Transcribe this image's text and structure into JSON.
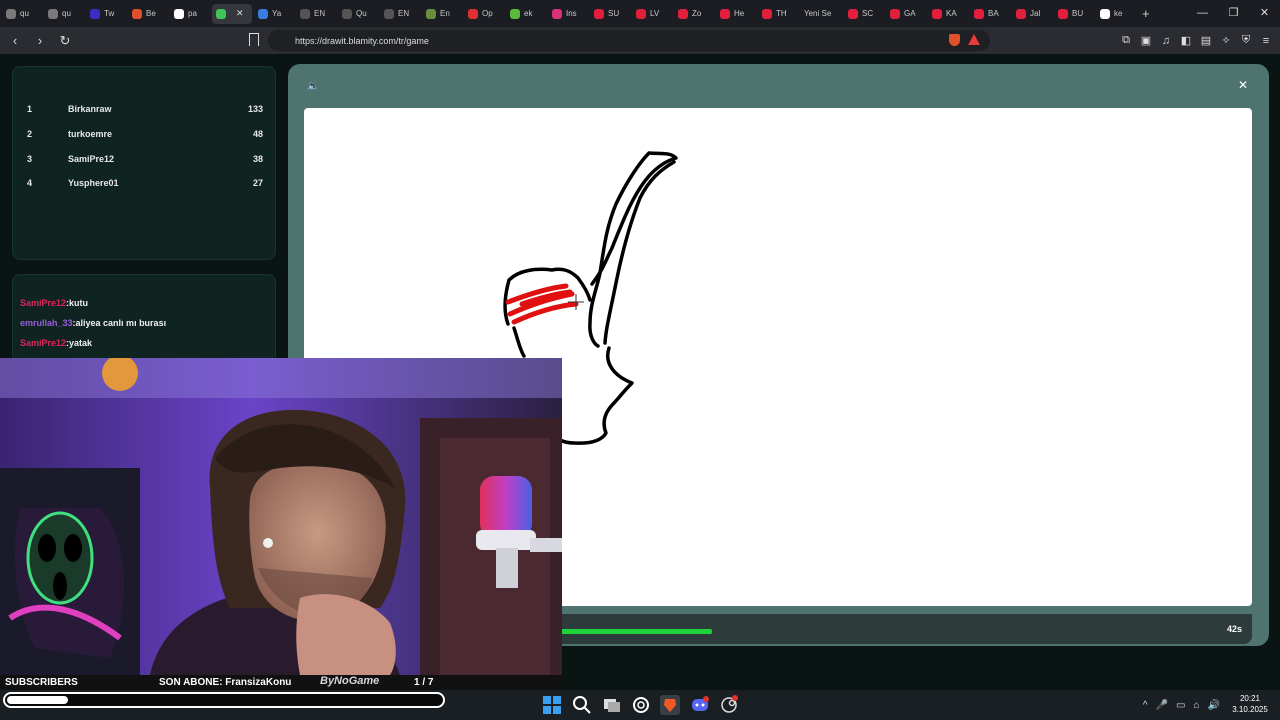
{
  "browser": {
    "tabs": [
      {
        "label": "qu",
        "color": "#7a7a7a"
      },
      {
        "label": "qu",
        "color": "#7a7a7a"
      },
      {
        "label": "Tw",
        "color": "#3b2cc7"
      },
      {
        "label": "Be",
        "color": "#e0502a"
      },
      {
        "label": "pa",
        "color": "#ffffff"
      },
      {
        "label": "",
        "color": "#41c45a",
        "active": true
      },
      {
        "label": "Ya",
        "color": "#3a7ce0"
      },
      {
        "label": "EN",
        "color": "#555555"
      },
      {
        "label": "Qu",
        "color": "#555555"
      },
      {
        "label": "EN",
        "color": "#555555"
      },
      {
        "label": "En",
        "color": "#6a8e3e"
      },
      {
        "label": "Op",
        "color": "#e03030"
      },
      {
        "label": "ek",
        "color": "#5ab83a"
      },
      {
        "label": "Ins",
        "color": "#d9307a"
      },
      {
        "label": "SU",
        "color": "#e01f3d"
      },
      {
        "label": "LV",
        "color": "#e01f3d"
      },
      {
        "label": "Zo",
        "color": "#e01f3d"
      },
      {
        "label": "He",
        "color": "#e01f3d"
      },
      {
        "label": "TH",
        "color": "#e01f3d"
      },
      {
        "label": "Yeni Se",
        "color": ""
      },
      {
        "label": "SC",
        "color": "#e01f3d"
      },
      {
        "label": "GA",
        "color": "#e01f3d"
      },
      {
        "label": "KA",
        "color": "#e01f3d"
      },
      {
        "label": "BA",
        "color": "#e01f3d"
      },
      {
        "label": "Jal",
        "color": "#e01f3d"
      },
      {
        "label": "BU",
        "color": "#e01f3d"
      },
      {
        "label": "ke",
        "color": "#ffffff"
      }
    ],
    "url": "https://drawit.blamity.com/tr/game",
    "new_tab_glyph": "+",
    "window_controls": [
      "—",
      "❐",
      "✕"
    ],
    "nav_glyphs": [
      "‹",
      "›",
      "↻"
    ],
    "extension_glyphs": [
      "⧉",
      "▣",
      "♫",
      "◧",
      "▤",
      "✧",
      "⛨",
      "≡"
    ]
  },
  "leaderboard": [
    {
      "rank": "1",
      "name": "Birkanraw",
      "score": "133"
    },
    {
      "rank": "2",
      "name": "turkoemre",
      "score": "48"
    },
    {
      "rank": "3",
      "name": "SamiPre12",
      "score": "38"
    },
    {
      "rank": "4",
      "name": "Yusphere01",
      "score": "27"
    }
  ],
  "chat": [
    {
      "user": "SamiPre12",
      "message": ":kutu",
      "color": "#e0245e"
    },
    {
      "user": "emrullah_33",
      "message": ":aliyea canlı mı burası",
      "color": "#9a5ce0"
    },
    {
      "user": "SamiPre12",
      "message": ":yatak",
      "color": "#e0245e"
    }
  ],
  "game": {
    "sound_glyph": "🔈",
    "close_glyph": "✕",
    "timer_text": "42s",
    "timer_progress": 0.45
  },
  "stream": {
    "subscribers_label": "SUBSCRIBERS",
    "last_sub_text": "SON ABONE: FransizaKonu",
    "brand_logo": "ByNoGame",
    "sub_count": "1  / 7",
    "sub_progress": 0.14
  },
  "taskbar": {
    "time": "20:21",
    "date": "3.10.2025",
    "tray_glyphs": [
      "^",
      "🎤",
      "▭",
      "⌂",
      "🔊"
    ]
  },
  "colors": {
    "accent_green": "#1fd13a",
    "panel_teal": "#4f736e",
    "chat_red": "#e0245e",
    "chat_purple": "#9a5ce0"
  }
}
